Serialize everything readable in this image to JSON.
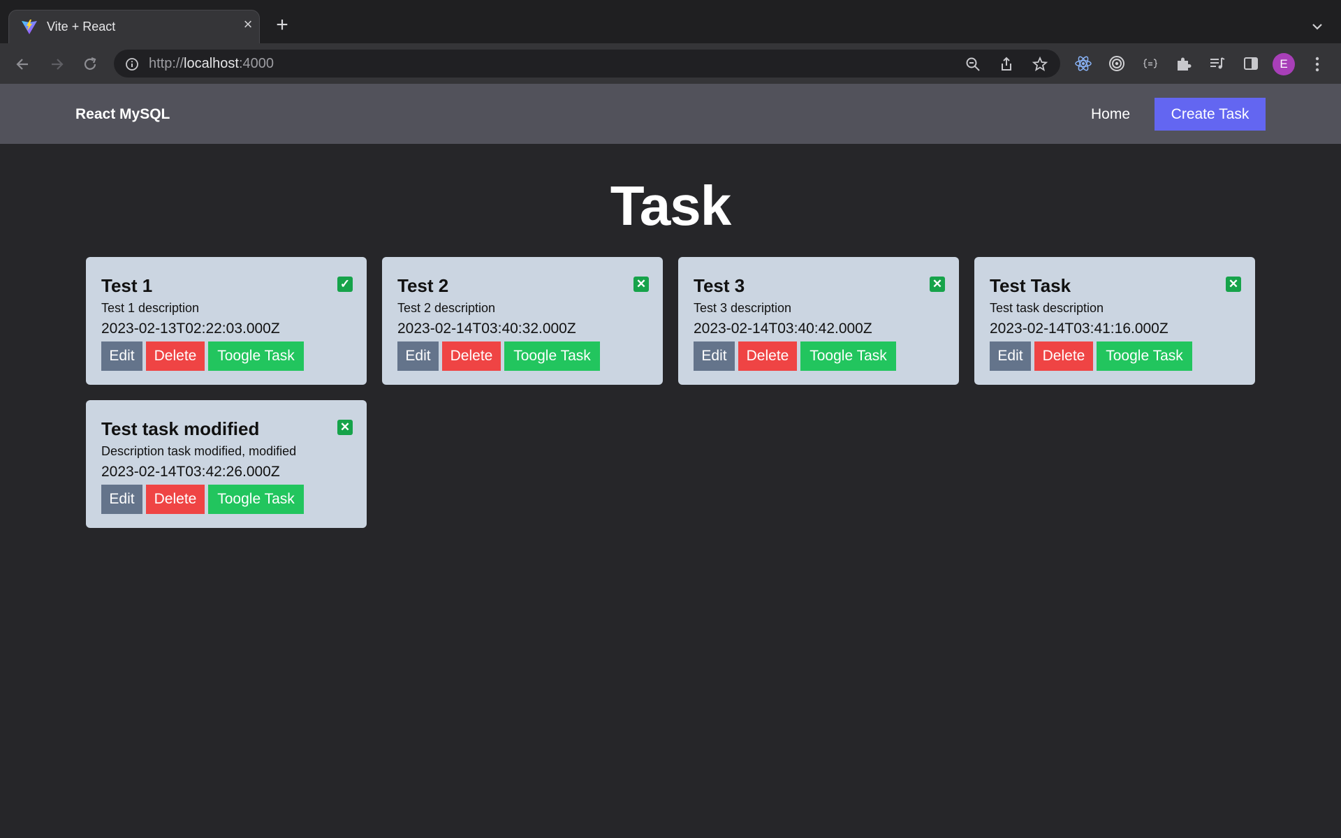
{
  "browser": {
    "tab_title": "Vite + React",
    "tab_close_icon": "close-icon",
    "new_tab_icon": "plus-icon",
    "url_scheme": "http://",
    "url_host": "localhost",
    "url_port": ":4000",
    "profile_initial": "E",
    "colors": {
      "avatar": "#a83fb8"
    }
  },
  "navbar": {
    "brand": "React MySQL",
    "home_label": "Home",
    "create_label": "Create Task",
    "colors": {
      "bar": "#52525b",
      "create_button": "#6366f1"
    }
  },
  "page": {
    "heading": "Task"
  },
  "tasks": [
    {
      "title": "Test 1",
      "description": "Test 1 description",
      "created_at": "2023-02-13T02:22:03.000Z",
      "done_icon": "✓",
      "done": true
    },
    {
      "title": "Test 2",
      "description": "Test 2 description",
      "created_at": "2023-02-14T03:40:32.000Z",
      "done_icon": "✕",
      "done": false
    },
    {
      "title": "Test 3",
      "description": "Test 3 description",
      "created_at": "2023-02-14T03:40:42.000Z",
      "done_icon": "✕",
      "done": false
    },
    {
      "title": "Test Task",
      "description": "Test task description",
      "created_at": "2023-02-14T03:41:16.000Z",
      "done_icon": "✕",
      "done": false
    },
    {
      "title": "Test task modified",
      "description": "Description task modified, modified",
      "created_at": "2023-02-14T03:42:26.000Z",
      "done_icon": "✕",
      "done": false
    }
  ],
  "task_buttons": {
    "edit": "Edit",
    "delete": "Delete",
    "toggle": "Toogle Task"
  },
  "colors": {
    "card": "#cbd5e1",
    "edit": "#64748b",
    "delete": "#ef4444",
    "toggle": "#22c55e",
    "status": "#16a34a",
    "background": "#262629"
  }
}
